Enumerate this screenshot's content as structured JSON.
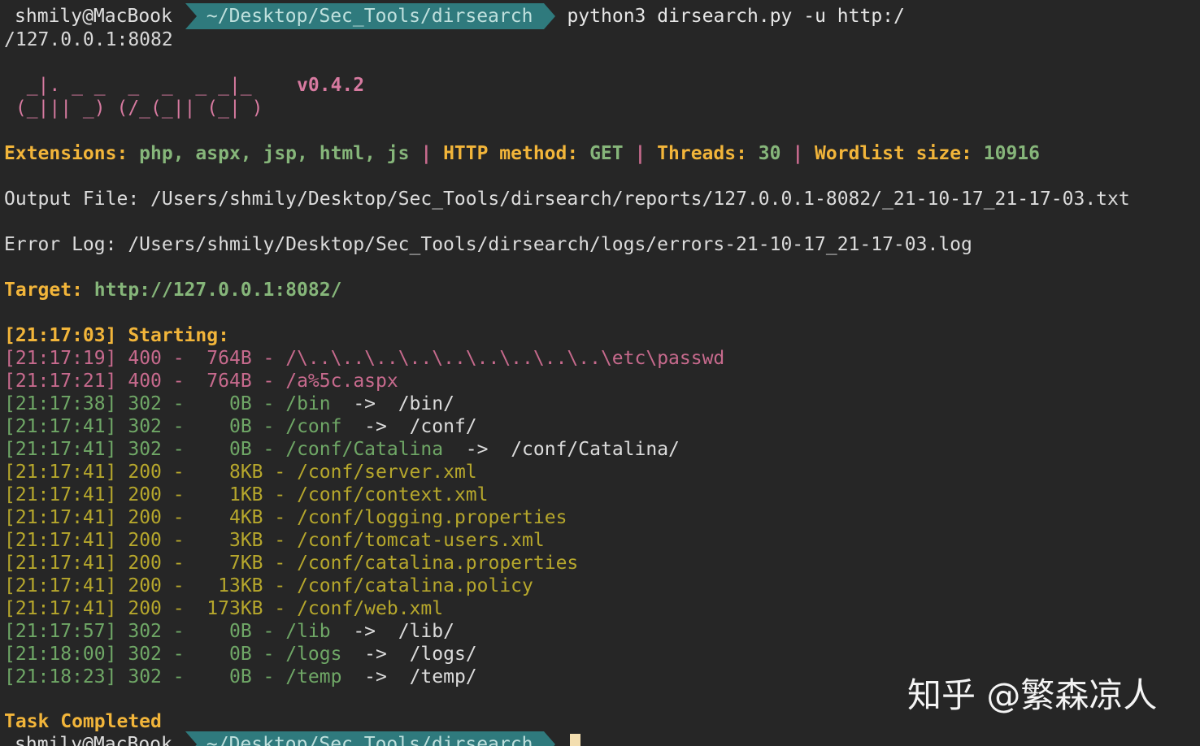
{
  "prompt_top": {
    "user": "shmily@MacBook",
    "path": "~/Desktop/Sec_Tools/dirsearch",
    "command_line1": "python3 dirsearch.py -u http:/",
    "command_line2": "/127.0.0.1:8082"
  },
  "banner": {
    "line1": "  _|. _ _  _  _  _ _|_    ",
    "version": "v0.4.2",
    "line2": " (_||| _) (/_(_|| (_| )"
  },
  "config": {
    "ext_label": "Extensions: ",
    "ext_value": "php, aspx, jsp, html, js",
    "sep": " | ",
    "method_label": "HTTP method: ",
    "method_value": "GET",
    "threads_label": "Threads: ",
    "threads_value": "30",
    "wordlist_label": "Wordlist size: ",
    "wordlist_value": "10916"
  },
  "output_file": "Output File: /Users/shmily/Desktop/Sec_Tools/dirsearch/reports/127.0.0.1-8082/_21-10-17_21-17-03.txt",
  "error_log": "Error Log: /Users/shmily/Desktop/Sec_Tools/dirsearch/logs/errors-21-10-17_21-17-03.log",
  "target": {
    "label": "Target: ",
    "value": "http://127.0.0.1:8082/"
  },
  "starting": "[21:17:03] Starting:",
  "results": [
    {
      "time": "[21:17:19]",
      "status": "400",
      "size": " 764B",
      "path": "/\\..\\..\\..\\..\\..\\..\\..\\..\\..\\etc\\passwd",
      "redirect": "",
      "kind": "err"
    },
    {
      "time": "[21:17:21]",
      "status": "400",
      "size": " 764B",
      "path": "/a%5c.aspx",
      "redirect": "",
      "kind": "err"
    },
    {
      "time": "[21:17:38]",
      "status": "302",
      "size": "   0B",
      "path": "/bin",
      "redirect": "  ->  /bin/",
      "kind": "redir"
    },
    {
      "time": "[21:17:41]",
      "status": "302",
      "size": "   0B",
      "path": "/conf",
      "redirect": "  ->  /conf/",
      "kind": "redir"
    },
    {
      "time": "[21:17:41]",
      "status": "302",
      "size": "   0B",
      "path": "/conf/Catalina",
      "redirect": "  ->  /conf/Catalina/",
      "kind": "redir"
    },
    {
      "time": "[21:17:41]",
      "status": "200",
      "size": "   8KB",
      "path": "/conf/server.xml",
      "redirect": "",
      "kind": "ok"
    },
    {
      "time": "[21:17:41]",
      "status": "200",
      "size": "   1KB",
      "path": "/conf/context.xml",
      "redirect": "",
      "kind": "ok"
    },
    {
      "time": "[21:17:41]",
      "status": "200",
      "size": "   4KB",
      "path": "/conf/logging.properties",
      "redirect": "",
      "kind": "ok"
    },
    {
      "time": "[21:17:41]",
      "status": "200",
      "size": "   3KB",
      "path": "/conf/tomcat-users.xml",
      "redirect": "",
      "kind": "ok"
    },
    {
      "time": "[21:17:41]",
      "status": "200",
      "size": "   7KB",
      "path": "/conf/catalina.properties",
      "redirect": "",
      "kind": "ok"
    },
    {
      "time": "[21:17:41]",
      "status": "200",
      "size": "  13KB",
      "path": "/conf/catalina.policy",
      "redirect": "",
      "kind": "ok"
    },
    {
      "time": "[21:17:41]",
      "status": "200",
      "size": " 173KB",
      "path": "/conf/web.xml",
      "redirect": "",
      "kind": "ok"
    },
    {
      "time": "[21:17:57]",
      "status": "302",
      "size": "   0B",
      "path": "/lib",
      "redirect": "  ->  /lib/",
      "kind": "redir"
    },
    {
      "time": "[21:18:00]",
      "status": "302",
      "size": "   0B",
      "path": "/logs",
      "redirect": "  ->  /logs/",
      "kind": "redir"
    },
    {
      "time": "[21:18:23]",
      "status": "302",
      "size": "   0B",
      "path": "/temp",
      "redirect": "  ->  /temp/",
      "kind": "redir"
    }
  ],
  "task_completed": "Task Completed",
  "prompt_bottom": {
    "user": "shmily@MacBook",
    "path": "~/Desktop/Sec_Tools/dirsearch"
  },
  "watermark": "知乎 @繁森凉人",
  "colors": {
    "background": "#262626",
    "prompt_path_bg": "#2f7a7d",
    "yellow": "#f2b53a",
    "green": "#86b67a",
    "pink": "#c76a8d",
    "olive": "#b6a72c"
  }
}
